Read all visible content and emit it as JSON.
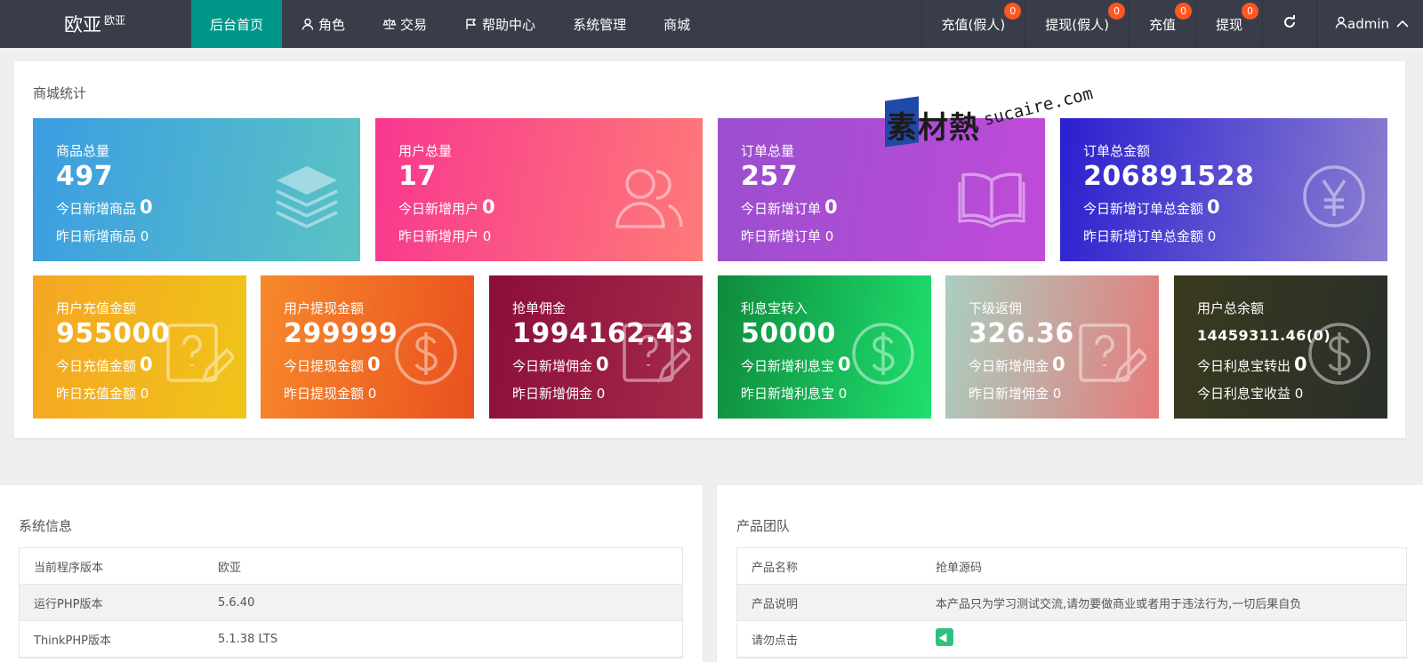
{
  "header": {
    "logo_main": "欧亚",
    "logo_sup": "欧亚",
    "nav": [
      {
        "label": "后台首页",
        "icon": ""
      },
      {
        "label": "角色",
        "icon": "user-icon"
      },
      {
        "label": "交易",
        "icon": "scale-icon"
      },
      {
        "label": "帮助中心",
        "icon": "flag-icon"
      },
      {
        "label": "系统管理",
        "icon": ""
      },
      {
        "label": "商城",
        "icon": ""
      }
    ],
    "right": [
      {
        "label": "充值(假人)",
        "badge": "0"
      },
      {
        "label": "提现(假人)",
        "badge": "0"
      },
      {
        "label": "充值",
        "badge": "0"
      },
      {
        "label": "提现",
        "badge": "0"
      }
    ],
    "user": "admin",
    "active_color": "#009688",
    "badge_color": "#ff5722"
  },
  "stats": {
    "title": "商城统计",
    "cards_top": [
      {
        "label": "商品总量",
        "value": "497",
        "today_label": "今日新增商品",
        "today_value": "0",
        "yest": "昨日新增商品 0",
        "icon": "layers-icon"
      },
      {
        "label": "用户总量",
        "value": "17",
        "today_label": "今日新增用户",
        "today_value": "0",
        "yest": "昨日新增用户 0",
        "icon": "users-icon"
      },
      {
        "label": "订单总量",
        "value": "257",
        "today_label": "今日新增订单",
        "today_value": "0",
        "yest": "昨日新增订单 0",
        "icon": "book-icon"
      },
      {
        "label": "订单总金额",
        "value": "206891528",
        "today_label": "今日新增订单总金额",
        "today_value": "0",
        "yest": "昨日新增订单总金额 0",
        "icon": "yen-icon"
      }
    ],
    "cards_bottom": [
      {
        "label": "用户充值金额",
        "value": "955000",
        "today_label": "今日充值金额",
        "today_value": "0",
        "yest": "昨日充值金额 0",
        "icon": "question-edit-icon"
      },
      {
        "label": "用户提现金额",
        "value": "299999",
        "today_label": "今日提现金额",
        "today_value": "0",
        "yest": "昨日提现金额 0",
        "icon": "dollar-icon"
      },
      {
        "label": "抢单佣金",
        "value": "1994162.43",
        "today_label": "今日新增佣金",
        "today_value": "0",
        "yest": "昨日新增佣金 0",
        "icon": "question-edit-icon"
      },
      {
        "label": "利息宝转入",
        "value": "50000",
        "today_label": "今日新增利息宝",
        "today_value": "0",
        "yest": "昨日新增利息宝 0",
        "icon": "dollar-icon"
      },
      {
        "label": "下级返佣",
        "value": "326.36",
        "today_label": "今日新增佣金",
        "today_value": "0",
        "yest": "昨日新增佣金 0",
        "icon": "question-edit-icon"
      },
      {
        "label": "用户总余额",
        "value": "14459311.46(0)",
        "today_label": "今日利息宝转出",
        "today_value": "0",
        "yest": "今日利息宝收益 0",
        "icon": "dollar-icon"
      }
    ]
  },
  "watermark": {
    "main": "素材熱",
    "sub": "sucaire.com"
  },
  "system_info": {
    "title": "系统信息",
    "rows": [
      {
        "k": "当前程序版本",
        "v": "欧亚"
      },
      {
        "k": "运行PHP版本",
        "v": "5.6.40"
      },
      {
        "k": "ThinkPHP版本",
        "v": "5.1.38 LTS"
      }
    ]
  },
  "product_team": {
    "title": "产品团队",
    "rows": [
      {
        "k": "产品名称",
        "v": "抢单源码"
      },
      {
        "k": "产品说明",
        "v": "本产品只为学习测试交流,请勿要做商业或者用于违法行为,一切后果自负"
      },
      {
        "k": "请勿点击",
        "v": ""
      }
    ]
  }
}
